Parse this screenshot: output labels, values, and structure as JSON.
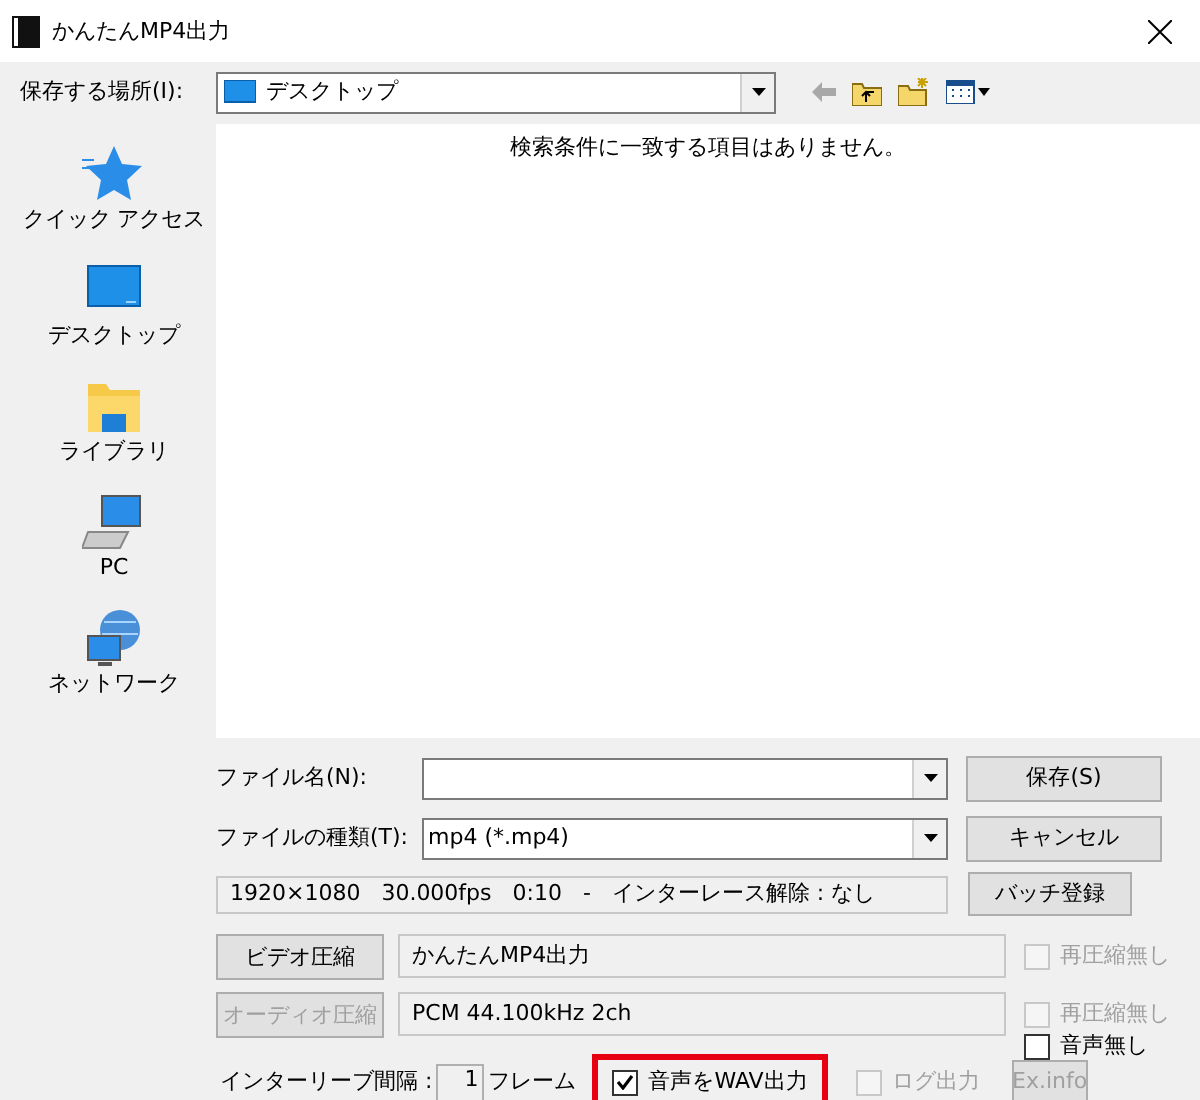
{
  "window": {
    "title": "かんたんMP4出力"
  },
  "save_in": {
    "label": "保存する場所(I):",
    "value": "デスクトップ"
  },
  "places": [
    {
      "label": "クイック アクセス",
      "kind": "star"
    },
    {
      "label": "デスクトップ",
      "kind": "desktop"
    },
    {
      "label": "ライブラリ",
      "kind": "library"
    },
    {
      "label": "PC",
      "kind": "pc"
    },
    {
      "label": "ネットワーク",
      "kind": "network"
    }
  ],
  "file_list": {
    "message": "検索条件に一致する項目はありません。"
  },
  "file_name": {
    "label": "ファイル名(N):"
  },
  "file_type": {
    "label": "ファイルの種類(T):",
    "value": "mp4 (*.mp4)"
  },
  "save_button": "保存(S)",
  "cancel_button": "キャンセル",
  "info": "1920×1080   30.000fps   0:10   -   インターレース解除 : なし",
  "batch_button": "バッチ登録",
  "video": {
    "button": "ビデオ圧縮",
    "disabled": false,
    "codec": "かんたんMP4出力",
    "checkboxes": [
      {
        "label": "再圧縮無し",
        "checked": false,
        "disabled": true
      }
    ]
  },
  "audio": {
    "button": "オーディオ圧縮",
    "disabled": true,
    "codec": "PCM 44.100kHz 2ch",
    "checkboxes": [
      {
        "label": "再圧縮無し",
        "checked": false,
        "disabled": true
      },
      {
        "label": "音声無し",
        "checked": false,
        "disabled": false
      }
    ]
  },
  "interleave": {
    "label": "インターリーブ間隔 :",
    "value": "1",
    "unit": "フレーム"
  },
  "options": [
    {
      "label": "音声をWAV出力",
      "checked": true,
      "disabled": false,
      "highlighted": true
    },
    {
      "label": "ログ出力",
      "checked": false,
      "disabled": true,
      "highlighted": false
    }
  ],
  "ex_info": {
    "label": "Ex.info",
    "disabled": true
  }
}
